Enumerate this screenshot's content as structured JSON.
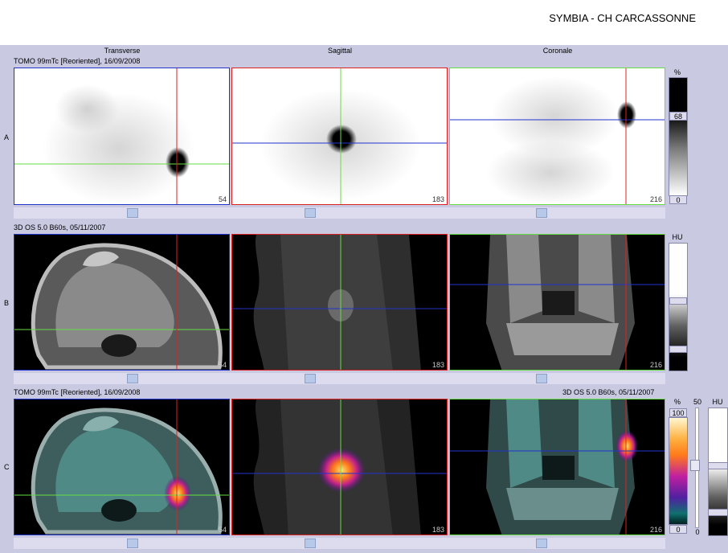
{
  "header": {
    "title": "SYMBIA - CH CARCASSONNE"
  },
  "views": {
    "transverse": "Transverse",
    "sagittal": "Sagittal",
    "coronal": "Coronale"
  },
  "rows": {
    "a": {
      "label": "A",
      "info": "TOMO 99mTc [Reoriented], 16/09/2008"
    },
    "b": {
      "label": "B",
      "info": "3D  OS  5.0  B60s, 05/11/2007"
    },
    "c": {
      "label": "C",
      "info_left": "TOMO 99mTc [Reoriented], 16/09/2008",
      "info_right": "3D  OS  5.0  B60s, 05/11/2007"
    }
  },
  "slices": {
    "transverse": "54",
    "sagittal": "183",
    "coronal": "216"
  },
  "colorbars": {
    "a": {
      "unit": "%",
      "window": "68",
      "min": "0"
    },
    "b": {
      "unit": "HU"
    },
    "c": {
      "unit": "%",
      "max": "100",
      "min": "0",
      "blend_max": "50",
      "blend_min": "0",
      "unit2": "HU"
    }
  },
  "colors": {
    "crosshair_red": "#dd2222",
    "crosshair_green": "#66dd44",
    "crosshair_blue": "#2233cc",
    "background": "#c9c9e2"
  }
}
